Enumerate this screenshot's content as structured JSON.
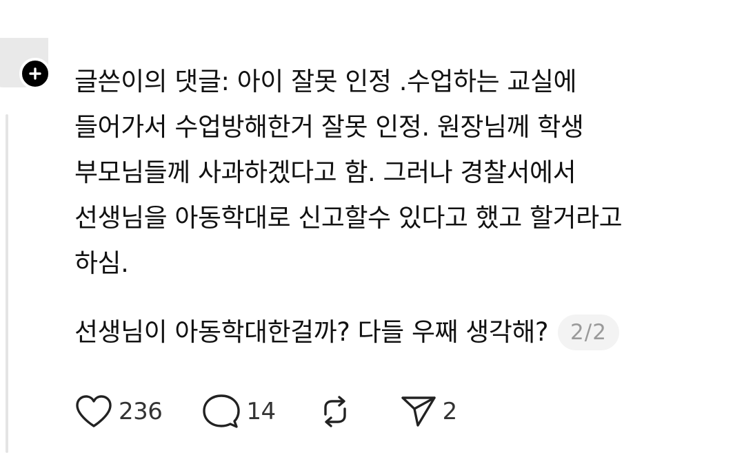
{
  "post": {
    "lines": [
      "글쓴이의 댓글: 아이 잘못 인정 .수업하는 교실에",
      "들어가서 수업방해한거 잘못 인정. 원장님께 학생",
      "부모님들께 사과하겠다고 함. 그러나 경찰서에서",
      "선생님을 아동학대로 신고할수 있다고 했고 할거라고",
      "하심."
    ],
    "question": "선생님이 아동학대한걸까? 다들 우째 생각해?",
    "page_indicator": "2/2"
  },
  "actions": {
    "like_count": "236",
    "comment_count": "14",
    "repost_count": "",
    "share_count": "2"
  },
  "icons": {
    "follow": "plus-icon",
    "like": "heart-icon",
    "comment": "comment-bubble-icon",
    "repost": "repost-icon",
    "share": "send-icon"
  }
}
